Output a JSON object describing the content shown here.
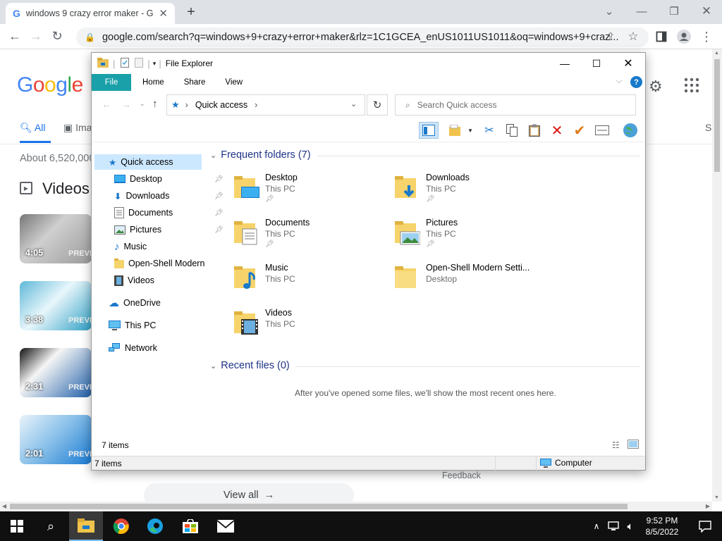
{
  "browser": {
    "tab_title": "windows 9 crazy error maker - G",
    "new_tab": "+",
    "url": "google.com/search?q=windows+9+crazy+error+maker&rlz=1C1GCEA_enUS1011US1011&oq=windows+9+craz..."
  },
  "google": {
    "logo": [
      "G",
      "o",
      "o",
      "g",
      "l",
      "e"
    ],
    "tab_all": "All",
    "tab_images": "Ima",
    "tab_right": "S",
    "results_count": "About 6,520,000",
    "videos_heading": "Videos",
    "videos": [
      {
        "duration": "4:05",
        "preview": "PREVI"
      },
      {
        "duration": "3:38",
        "preview": "PREVI"
      },
      {
        "duration": "2:31",
        "preview": "PREVI"
      },
      {
        "duration": "2:01",
        "preview": "PREVI"
      }
    ],
    "view_all": "View all",
    "feedback": "Feedback"
  },
  "explorer": {
    "title": "File Explorer",
    "ribbon_tabs": [
      "File",
      "Home",
      "Share",
      "View"
    ],
    "breadcrumb": "Quick access",
    "search_placeholder": "Search Quick access",
    "nav": {
      "quick_access": "Quick access",
      "pinned": [
        "Desktop",
        "Downloads",
        "Documents",
        "Pictures"
      ],
      "unpinned": [
        "Music",
        "Open-Shell Modern",
        "Videos"
      ],
      "onedrive": "OneDrive",
      "this_pc": "This PC",
      "network": "Network"
    },
    "frequent_header": "Frequent folders (7)",
    "folders": [
      {
        "name": "Desktop",
        "location": "This PC"
      },
      {
        "name": "Downloads",
        "location": "This PC"
      },
      {
        "name": "Documents",
        "location": "This PC"
      },
      {
        "name": "Pictures",
        "location": "This PC"
      },
      {
        "name": "Music",
        "location": "This PC"
      },
      {
        "name": "Open-Shell Modern Setti...",
        "location": "Desktop"
      },
      {
        "name": "Videos",
        "location": "This PC"
      }
    ],
    "recent_header": "Recent files (0)",
    "recent_empty": "After you've opened some files, we'll show the most recent ones here.",
    "status_items": "7 items",
    "status_items_bottom": "7 items",
    "status_computer": "Computer"
  },
  "taskbar": {
    "time": "9:52 PM",
    "date": "8/5/2022"
  },
  "colors": {
    "file_tab": "#19a0a8",
    "google_blue": "#4285f4",
    "taskbar": "#101010"
  }
}
